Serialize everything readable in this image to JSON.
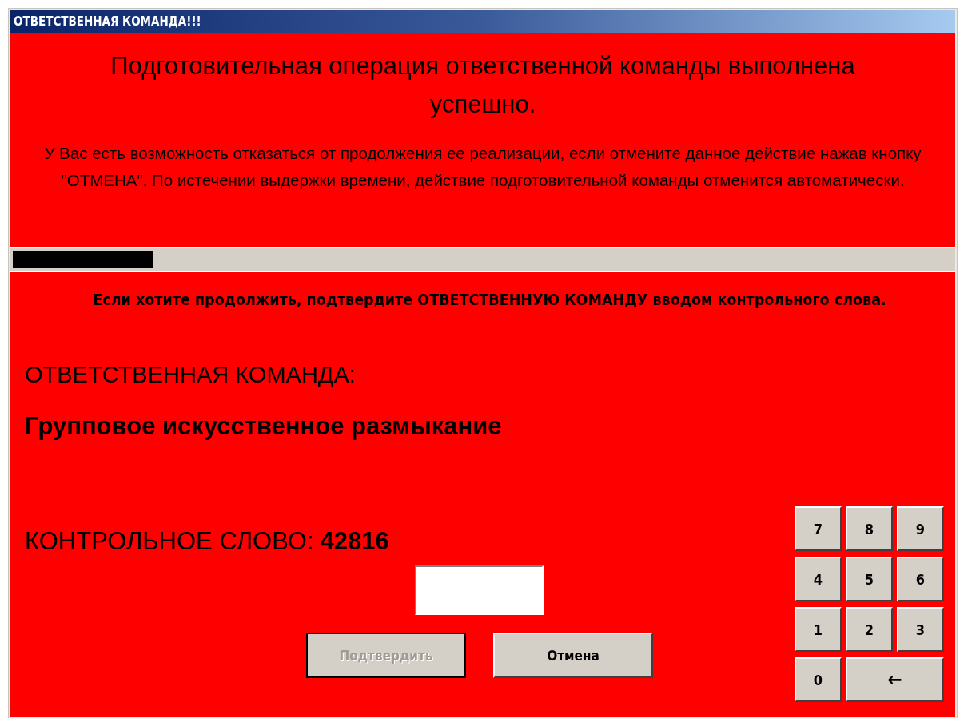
{
  "window": {
    "title": "ОТВЕТСТВЕННАЯ КОМАНДА!!!"
  },
  "message": {
    "heading": "Подготовительная операция ответственной команды выполнена успешно.",
    "text": "У Вас есть возможность отказаться от продолжения ее реализации, если отмените данное действие нажав кнопку \"ОТМЕНА\". По истечении выдержки времени, действие подготовительной команды отменится автоматически."
  },
  "progress": {
    "level": 0.15
  },
  "instruction": "Если хотите продолжить, подтвердите ОТВЕТСТВЕННУЮ КОМАНДУ вводом контрольного слова.",
  "command": {
    "label": "ОТВЕТСТВЕННАЯ КОМАНДА:",
    "name": "Групповое искусственное размыкание"
  },
  "control_word": {
    "label": "КОНТРОЛЬНОЕ СЛОВО:",
    "value": "42816"
  },
  "buttons": [
    {
      "label": "Подтвердить",
      "disabled": true
    },
    {
      "label": "Отмена",
      "disabled": false
    }
  ],
  "keypad": [
    {
      "label": "7",
      "kind": "digit"
    },
    {
      "label": "8",
      "kind": "digit"
    },
    {
      "label": "9",
      "kind": "digit"
    },
    {
      "label": "4",
      "kind": "digit"
    },
    {
      "label": "5",
      "kind": "digit"
    },
    {
      "label": "6",
      "kind": "digit"
    },
    {
      "label": "1",
      "kind": "digit"
    },
    {
      "label": "2",
      "kind": "digit"
    },
    {
      "label": "3",
      "kind": "digit"
    },
    {
      "label": "0",
      "kind": "digit"
    },
    {
      "label": "←",
      "kind": "backspace"
    }
  ]
}
